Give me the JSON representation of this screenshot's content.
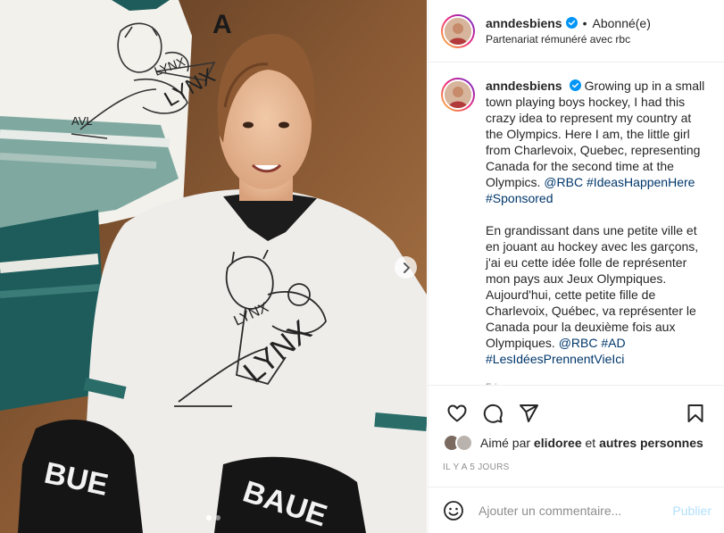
{
  "post": {
    "username": "anndesbiens",
    "separator": "•",
    "follow_state": "Abonné(e)",
    "partnership": "Partenariat rémunéré avec rbc",
    "carousel": {
      "slide_count": 2,
      "active_slide": 1
    }
  },
  "caption": {
    "username": "anndesbiens",
    "english_text": "Growing up in a small town playing boys hockey, I had this crazy idea to represent my country at the Olympics. Here I am, the little girl from Charlevoix, Quebec, representing Canada for the second time at the Olympics.",
    "english_tags": [
      "@RBC",
      "#IdeasHappenHere",
      "#Sponsored"
    ],
    "french_text": "En grandissant dans une petite ville et en jouant au hockey avec les garçons, j'ai eu cette idée folle de représenter mon pays aux Jeux Olympiques. Aujourd'hui, cette petite fille de Charlevoix, Québec, va représenter le Canada pour la deuxième fois aux Olympiques.",
    "french_tags": [
      "@RBC",
      "#AD",
      "#LesIdéesPrennentVieIci"
    ],
    "time_ago": "5 j"
  },
  "engagement": {
    "liked_by_prefix": "Aimé par",
    "liked_by_user": "elidoree",
    "liked_by_connector": "et",
    "liked_by_others": "autres personnes",
    "date_label": "IL Y A 5 JOURS"
  },
  "comment_box": {
    "placeholder": "Ajouter un commentaire...",
    "publish_label": "Publier"
  },
  "icons": {
    "verified": "verified-badge-icon",
    "like": "heart-icon",
    "comment": "speech-bubble-icon",
    "share": "paper-plane-icon",
    "save": "bookmark-icon",
    "emoji": "smiley-icon",
    "next": "chevron-right-icon"
  },
  "colors": {
    "accent": "#0095f6",
    "link": "#00376b",
    "muted": "#8e8e8e",
    "publish_disabled": "#b2dffc"
  }
}
